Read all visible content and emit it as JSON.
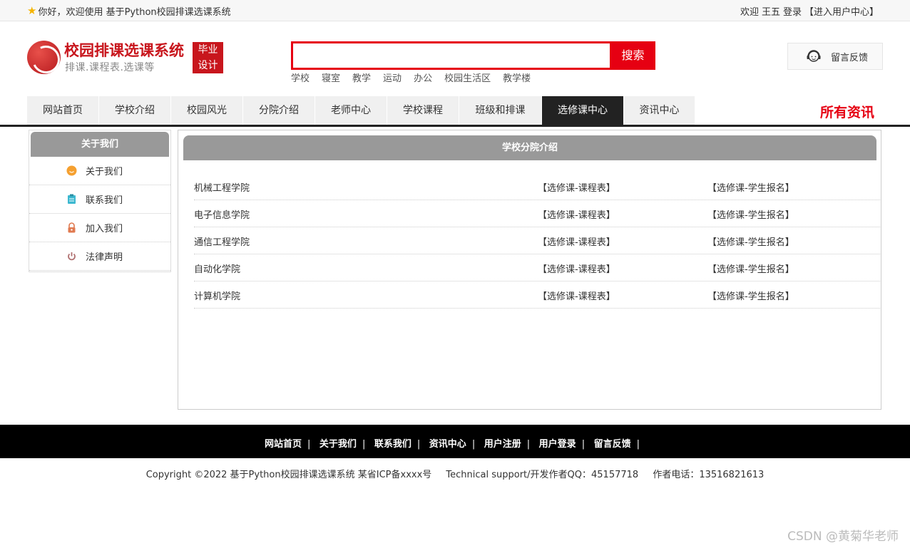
{
  "topbar": {
    "welcome": "你好，欢迎使用 基于Python校园排课选课系统",
    "greeting": "欢迎",
    "username": "王五",
    "login": "登录",
    "user_center": "【进入用户中心】"
  },
  "header": {
    "title": "校园排课选课系统",
    "subtitle": "排课.课程表.选课等",
    "badge_line1": "毕业",
    "badge_line2": "设计",
    "search_value": "",
    "search_button": "搜索",
    "hot_words": [
      "学校",
      "寝室",
      "教学",
      "运动",
      "办公",
      "校园生活区",
      "教学楼"
    ],
    "feedback": "留言反馈"
  },
  "nav": {
    "items": [
      "网站首页",
      "学校介绍",
      "校园风光",
      "分院介绍",
      "老师中心",
      "学校课程",
      "班级和排课",
      "选修课中心",
      "资讯中心"
    ],
    "active_index": 7,
    "all_news": "所有资讯"
  },
  "sidebar": {
    "title": "关于我们",
    "items": [
      "关于我们",
      "联系我们",
      "加入我们",
      "法律声明"
    ]
  },
  "main": {
    "title": "学校分院介绍",
    "rows": [
      {
        "name": "机械工程学院",
        "link1": "【选修课-课程表】",
        "link2": "【选修课-学生报名】"
      },
      {
        "name": "电子信息学院",
        "link1": "【选修课-课程表】",
        "link2": "【选修课-学生报名】"
      },
      {
        "name": "通信工程学院",
        "link1": "【选修课-课程表】",
        "link2": "【选修课-学生报名】"
      },
      {
        "name": "自动化学院",
        "link1": "【选修课-课程表】",
        "link2": "【选修课-学生报名】"
      },
      {
        "name": "计算机学院",
        "link1": "【选修课-课程表】",
        "link2": "【选修课-学生报名】"
      }
    ]
  },
  "footer": {
    "links": [
      "网站首页",
      "关于我们",
      "联系我们",
      "资讯中心",
      "用户注册",
      "用户登录",
      "留言反馈"
    ],
    "copyright": "Copyright ©2022 基于Python校园排课选课系统 某省ICP备xxxx号",
    "support": "Technical support/开发作者QQ：45157718",
    "phone": "作者电话：13516821613"
  },
  "watermark": "CSDN @黄菊华老师",
  "colors": {
    "accent": "#e60012",
    "brand": "#c8161d",
    "nav_active": "#222222",
    "panel_head": "#999999"
  }
}
